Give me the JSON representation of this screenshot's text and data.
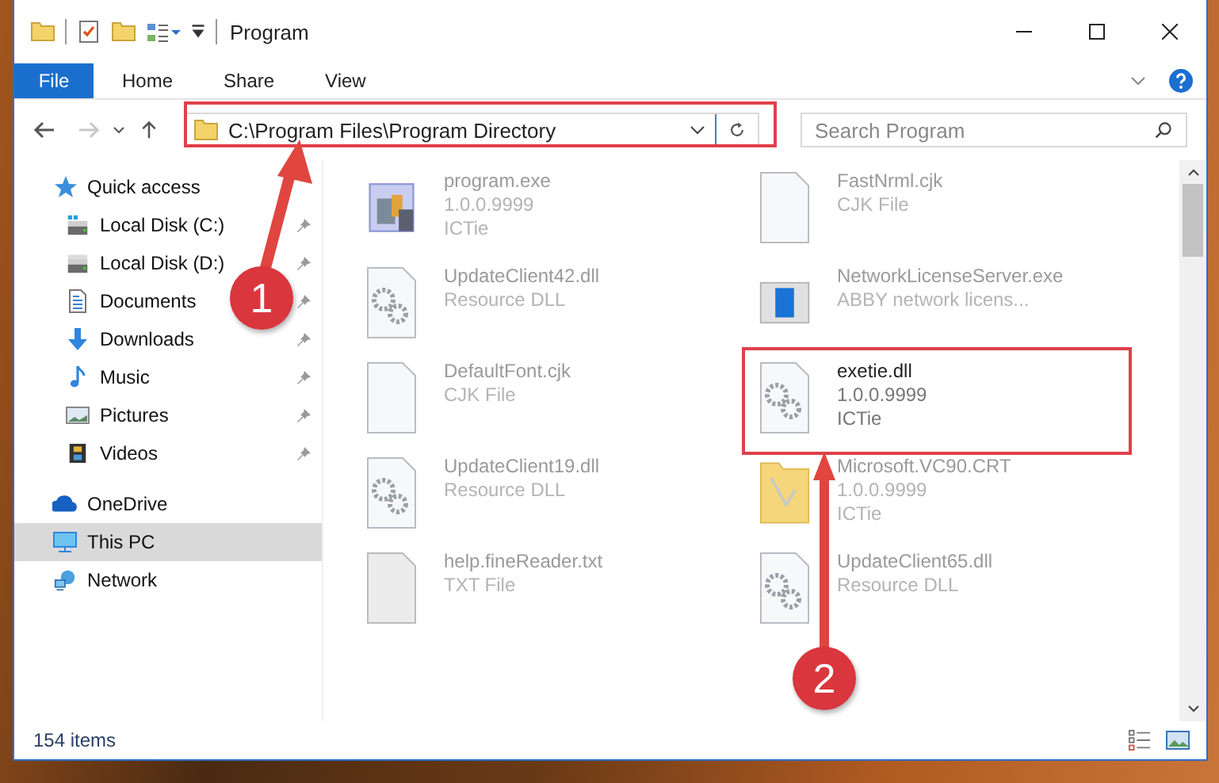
{
  "window": {
    "title": "Program"
  },
  "ribbon_tabs": [
    {
      "label": "File",
      "kind": "file"
    },
    {
      "label": "Home",
      "kind": "tab"
    },
    {
      "label": "Share",
      "kind": "tab"
    },
    {
      "label": "View",
      "kind": "tab"
    }
  ],
  "address": {
    "path": "C:\\Program Files\\Program Directory"
  },
  "search": {
    "placeholder": "Search Program"
  },
  "navigation": [
    {
      "label": "Quick access",
      "selected": false,
      "children": [
        {
          "label": "Local Disk (C:)",
          "pinned": true,
          "selected": false
        },
        {
          "label": "Local Disk (D:)",
          "pinned": true,
          "selected": false
        },
        {
          "label": "Documents",
          "pinned": true,
          "selected": false
        },
        {
          "label": "Downloads",
          "pinned": true,
          "selected": false
        },
        {
          "label": "Music",
          "pinned": true,
          "selected": false
        },
        {
          "label": "Pictures",
          "pinned": true,
          "selected": false
        },
        {
          "label": "Videos",
          "pinned": true,
          "selected": false
        }
      ]
    },
    {
      "label": "OneDrive",
      "selected": false
    },
    {
      "label": "This PC",
      "selected": true
    },
    {
      "label": "Network",
      "selected": false
    }
  ],
  "files": [
    {
      "name": "program.exe",
      "details": [
        "1.0.0.9999",
        "ICTie"
      ],
      "kind": "exe",
      "focused": false
    },
    {
      "name": "FastNrml.cjk",
      "details": [
        "CJK File"
      ],
      "kind": "cjk",
      "focused": false
    },
    {
      "name": "UpdateClient42.dll",
      "details": [
        "Resource DLL"
      ],
      "kind": "dll",
      "focused": false
    },
    {
      "name": "NetworkLicenseServer.exe",
      "details": [
        "ABBY network licens..."
      ],
      "kind": "server",
      "focused": false
    },
    {
      "name": "DefaultFont.cjk",
      "details": [
        "CJK File"
      ],
      "kind": "cjk",
      "focused": false
    },
    {
      "name": "exetie.dll",
      "details": [
        "1.0.0.9999",
        "ICTie"
      ],
      "kind": "dll",
      "focused": true
    },
    {
      "name": "UpdateClient19.dll",
      "details": [
        "Resource DLL"
      ],
      "kind": "dll",
      "focused": false
    },
    {
      "name": "Microsoft.VC90.CRT",
      "details": [
        "1.0.0.9999",
        "ICTie"
      ],
      "kind": "folder",
      "focused": false
    },
    {
      "name": "help.fineReader.txt",
      "details": [
        "TXT File"
      ],
      "kind": "txt",
      "focused": false
    },
    {
      "name": "UpdateClient65.dll",
      "details": [
        "Resource DLL"
      ],
      "kind": "dll",
      "focused": false
    }
  ],
  "status_bar": {
    "item_count": "154 items"
  },
  "annotations": [
    {
      "number": "1"
    },
    {
      "number": "2"
    }
  ]
}
